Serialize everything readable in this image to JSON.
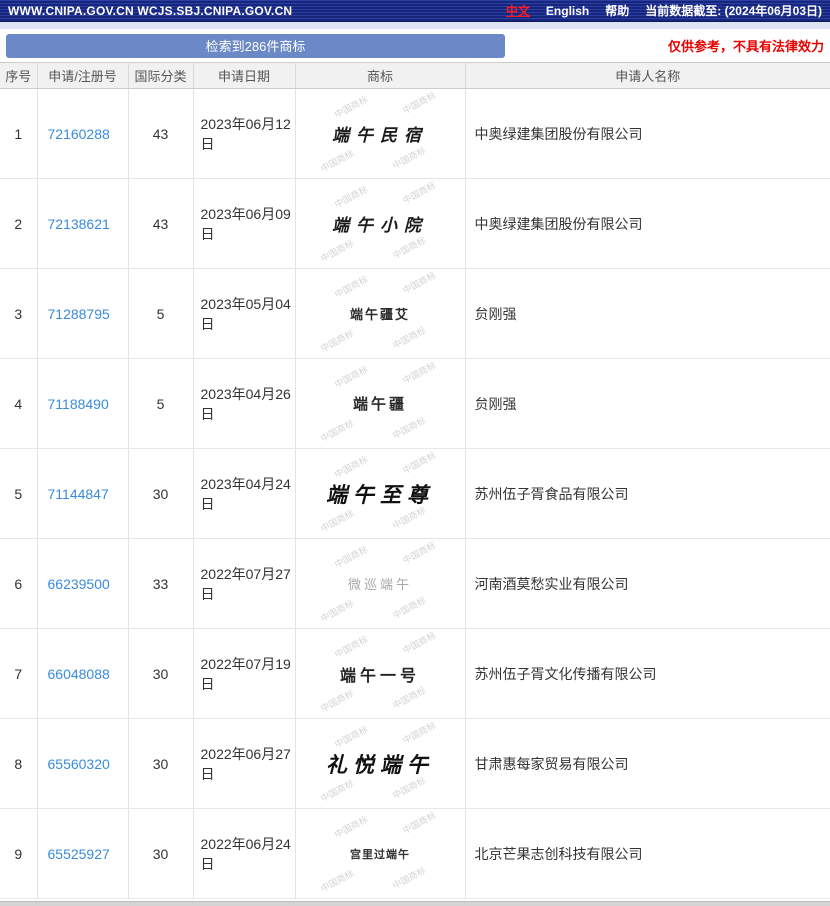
{
  "topbar": {
    "site_text": "WWW.CNIPA.GOV.CN WCJS.SBJ.CNIPA.GOV.CN",
    "lang_zh": "中文",
    "lang_en": "English",
    "help": "帮助",
    "data_cutoff": "当前数据截至: (2024年06月03日)"
  },
  "results": {
    "summary": "检索到286件商标",
    "disclaimer": "仅供参考，不具有法律效力"
  },
  "watermark": "中国商标",
  "colors": {
    "topbar_navy": "#1b2c8c",
    "button_blue": "#6a89c6",
    "link_blue": "#3a8bdd",
    "disclaimer_red": "#e60000"
  },
  "table": {
    "headers": [
      "序号",
      "申请/注册号",
      "国际分类",
      "申请日期",
      "商标",
      "申请人名称"
    ],
    "rows": [
      {
        "no": "1",
        "app_no": "72160288",
        "class": "43",
        "date": "2023年06月12日",
        "mark": "端午民宿",
        "mark_style": "callig-md",
        "applicant": "中奥绿建集团股份有限公司"
      },
      {
        "no": "2",
        "app_no": "72138621",
        "class": "43",
        "date": "2023年06月09日",
        "mark": "端午小院",
        "mark_style": "callig-md",
        "applicant": "中奥绿建集团股份有限公司"
      },
      {
        "no": "3",
        "app_no": "71288795",
        "class": "5",
        "date": "2023年05月04日",
        "mark": "端午疆艾",
        "mark_style": "print-sm",
        "applicant": "贠刚强"
      },
      {
        "no": "4",
        "app_no": "71188490",
        "class": "5",
        "date": "2023年04月26日",
        "mark": "端午疆",
        "mark_style": "print-md",
        "applicant": "贠刚强"
      },
      {
        "no": "5",
        "app_no": "71144847",
        "class": "30",
        "date": "2023年04月24日",
        "mark": "端午至尊",
        "mark_style": "callig-lg",
        "applicant": "苏州伍子胥食品有限公司"
      },
      {
        "no": "6",
        "app_no": "66239500",
        "class": "33",
        "date": "2022年07月27日",
        "mark": "微巡端午",
        "mark_style": "faint",
        "applicant": "河南酒莫愁实业有限公司"
      },
      {
        "no": "7",
        "app_no": "66048088",
        "class": "30",
        "date": "2022年07月19日",
        "mark": "端午一号",
        "mark_style": "bold-md",
        "applicant": "苏州伍子胥文化传播有限公司"
      },
      {
        "no": "8",
        "app_no": "65560320",
        "class": "30",
        "date": "2022年06月27日",
        "mark": "礼悦端午",
        "mark_style": "callig-lg",
        "applicant": "甘肃惠每家贸易有限公司"
      },
      {
        "no": "9",
        "app_no": "65525927",
        "class": "30",
        "date": "2022年06月24日",
        "mark": "宫里过端午",
        "mark_style": "bold-sm",
        "applicant": "北京芒果志创科技有限公司"
      }
    ]
  }
}
